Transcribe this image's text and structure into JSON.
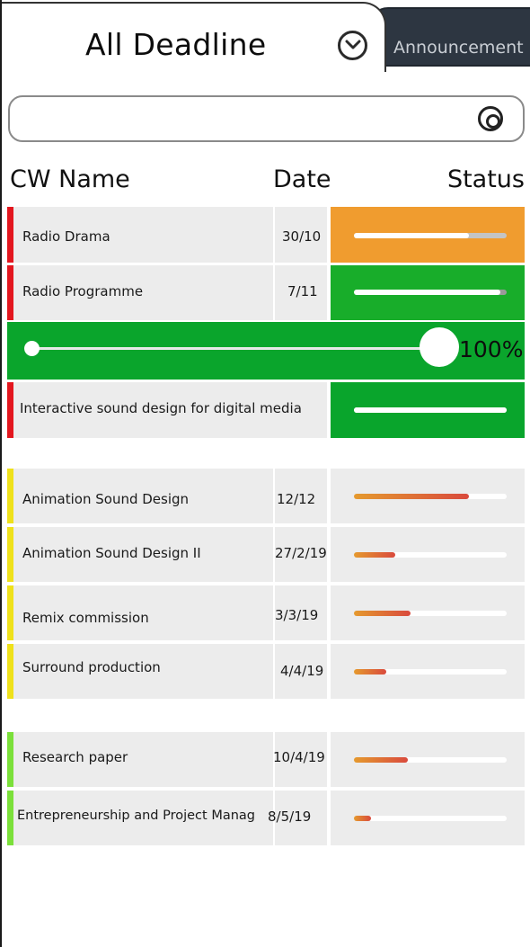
{
  "header": {
    "title": "All Deadline",
    "dropdown_icon": "chevron-down-icon",
    "tab_announcement": "Announcement"
  },
  "search": {
    "value": "",
    "placeholder": "",
    "icon": "search-icon"
  },
  "columns": {
    "name": "CW Name",
    "date": "Date",
    "status": "Status"
  },
  "colors": {
    "red": "#e3161e",
    "yellow": "#efe11b",
    "green": "#7be03a",
    "orange_status": "#f09c2f",
    "green_status": "#18ad2a",
    "green_strong": "#09a52c",
    "progress_start": "#e59a2e",
    "progress_end": "#d94a3d"
  },
  "groups": [
    {
      "accent": "red",
      "items": [
        {
          "name": "Radio Drama",
          "date": "30/10",
          "progress": 0.75,
          "status_bg": "orange_status",
          "style": "light"
        },
        {
          "name": "Radio Programme",
          "date": "7/11",
          "progress": 0.96,
          "status_bg": "green_status",
          "style": "light"
        }
      ]
    }
  ],
  "slider": {
    "value_label": "100%",
    "value": 1.0
  },
  "expanded_item": {
    "name": "Interactive sound design for digital media",
    "date": "",
    "progress": 1.0,
    "status_bg": "green_strong",
    "style": "light"
  },
  "group_yellow": {
    "accent": "yellow",
    "items": [
      {
        "name": "Animation Sound Design",
        "date": "12/12",
        "progress": 0.75
      },
      {
        "name": "Animation Sound Design II",
        "date": "27/2/19",
        "progress": 0.27
      },
      {
        "name": "Remix commission",
        "date": "3/3/19",
        "progress": 0.37
      },
      {
        "name": "Surround production",
        "date": "4/4/19",
        "progress": 0.21
      }
    ]
  },
  "group_green": {
    "accent": "green",
    "items": [
      {
        "name": "Research paper",
        "date": "10/4/19",
        "progress": 0.35
      },
      {
        "name": "Entrepreneurship and Project Manag",
        "date": "8/5/19",
        "progress": 0.11
      }
    ]
  }
}
